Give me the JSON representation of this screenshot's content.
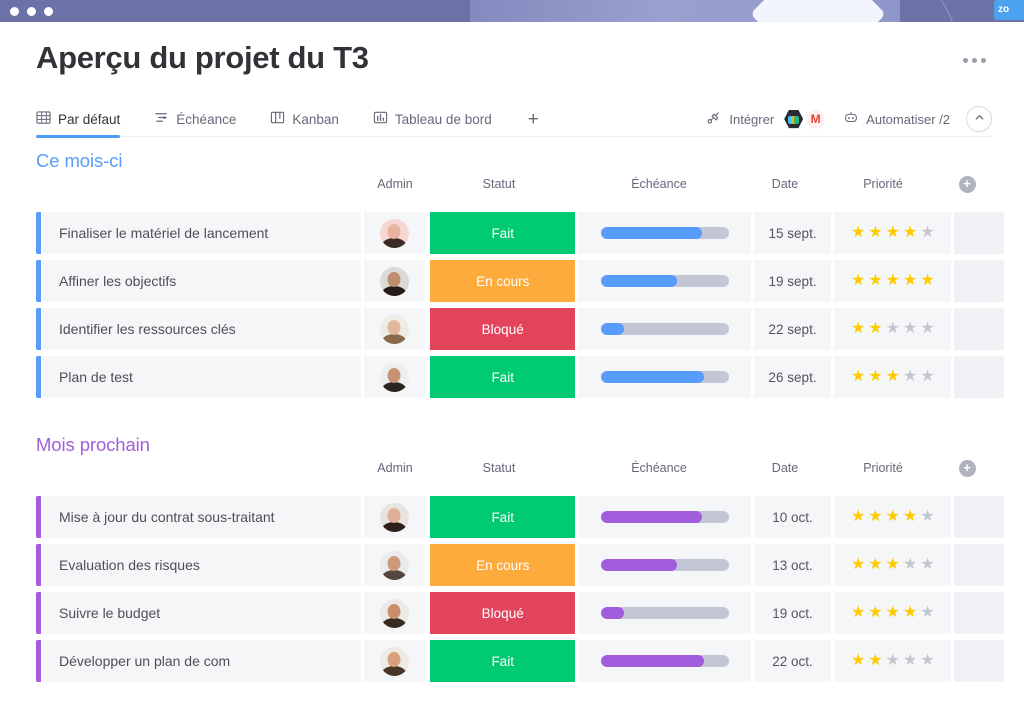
{
  "window": {
    "traffic_dots": 3,
    "corner_tag": "zo"
  },
  "header": {
    "title": "Aperçu du projet du T3",
    "more_menu": "more-options"
  },
  "tabs": [
    {
      "label": "Par défaut",
      "icon": "table-grid-icon",
      "active": true
    },
    {
      "label": "Échéance",
      "icon": "gantt-icon",
      "active": false
    },
    {
      "label": "Kanban",
      "icon": "kanban-icon",
      "active": false
    },
    {
      "label": "Tableau de bord",
      "icon": "bar-chart-icon",
      "active": false
    }
  ],
  "tab_add_label": "+",
  "toolbar": {
    "integrate_label": "Intégrer",
    "integrate_icon": "integrate-icon",
    "apps": [
      {
        "name": "slack-icon",
        "label": ""
      },
      {
        "name": "gmail-icon",
        "label": "M"
      }
    ],
    "automate_label": "Automatiser /2",
    "automate_icon": "robot-icon",
    "collapse_icon": "chevron-up-icon"
  },
  "columns": [
    "Admin",
    "Statut",
    "Échéance",
    "Date",
    "Priorité"
  ],
  "add_column_label": "+",
  "colors": {
    "done": "#00ca72",
    "working": "#fdab3d",
    "stuck": "#e2445c",
    "group1_accent": "#579bfc",
    "group2_accent": "#a25ddc",
    "star_on": "#ffcb00",
    "star_off": "#c5c7d0"
  },
  "groups": [
    {
      "title": "Ce mois-ci",
      "color": "#579bfc",
      "rows": [
        {
          "name": "Finaliser le matériel de lancement",
          "owner": "avatar-woman-1",
          "status": "Fait",
          "status_color": "#00ca72",
          "progress": 79,
          "date": "15 sept.",
          "priority": 4
        },
        {
          "name": "Affiner les objectifs",
          "owner": "avatar-woman-2",
          "status": "En cours",
          "status_color": "#fdab3d",
          "progress": 60,
          "date": "19 sept.",
          "priority": 5
        },
        {
          "name": "Identifier les ressources clés",
          "owner": "avatar-woman-3",
          "status": "Bloqué",
          "status_color": "#e2445c",
          "progress": 18,
          "date": "22 sept.",
          "priority": 2
        },
        {
          "name": "Plan de test",
          "owner": "avatar-man-1",
          "status": "Fait",
          "status_color": "#00ca72",
          "progress": 81,
          "date": "26 sept.",
          "priority": 3
        }
      ]
    },
    {
      "title": "Mois prochain",
      "color": "#a25ddc",
      "rows": [
        {
          "name": "Mise à jour du contrat sous-traitant",
          "owner": "avatar-woman-4",
          "status": "Fait",
          "status_color": "#00ca72",
          "progress": 79,
          "date": "10 oct.",
          "priority": 4
        },
        {
          "name": "Evaluation des risques",
          "owner": "avatar-man-2",
          "status": "En cours",
          "status_color": "#fdab3d",
          "progress": 60,
          "date": "13 oct.",
          "priority": 3
        },
        {
          "name": "Suivre le budget",
          "owner": "avatar-man-3",
          "status": "Bloqué",
          "status_color": "#e2445c",
          "progress": 18,
          "date": "19 oct.",
          "priority": 4
        },
        {
          "name": "Développer un plan de com",
          "owner": "avatar-man-4",
          "status": "Fait",
          "status_color": "#00ca72",
          "progress": 81,
          "date": "22 oct.",
          "priority": 2
        }
      ]
    }
  ]
}
